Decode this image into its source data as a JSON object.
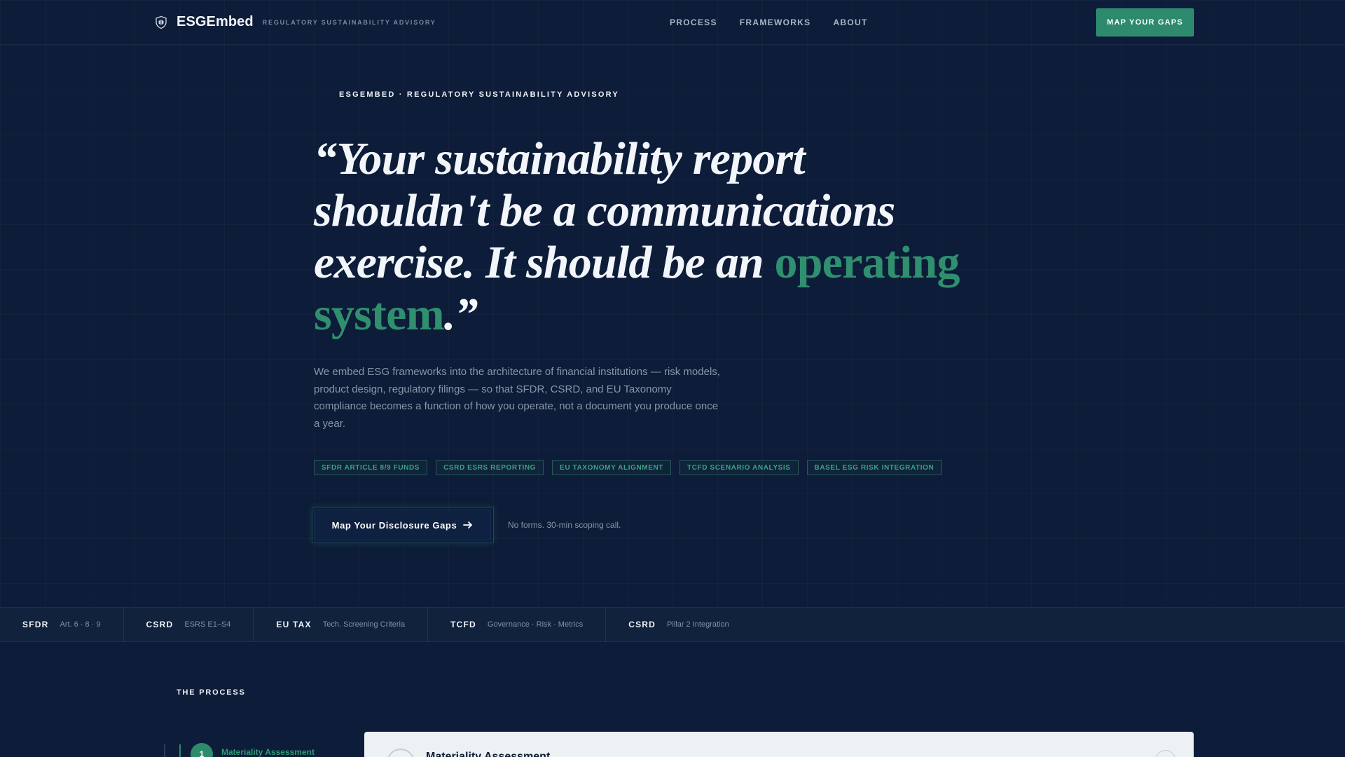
{
  "nav": {
    "brand": "ESGEmbed",
    "tagline": "REGULATORY SUSTAINABILITY ADVISORY",
    "links": [
      "PROCESS",
      "FRAMEWORKS",
      "ABOUT"
    ],
    "cta": "MAP YOUR GAPS"
  },
  "hero": {
    "eyebrow": "ESGEMBED · REGULATORY SUSTAINABILITY ADVISORY",
    "quote_part1": "“Your sustainability report shouldn't be a communications exercise. It should be an ",
    "quote_accent": "operating system",
    "quote_part2": ".”",
    "lede": "We embed ESG frameworks into the architecture of financial institutions — risk models, product design, regulatory filings — so that SFDR, CSRD, and EU Taxonomy compliance becomes a function of how you operate, not a document you produce once a year.",
    "tags": [
      "SFDR ARTICLE 8/9 FUNDS",
      "CSRD ESRS REPORTING",
      "EU TAXONOMY ALIGNMENT",
      "TCFD SCENARIO ANALYSIS",
      "BASEL ESG RISK INTEGRATION"
    ],
    "cta": "Map Your Disclosure Gaps",
    "cta_note": "No forms. 30-min scoping call."
  },
  "ticker": [
    {
      "code": "SFDR",
      "desc": "Art. 6 · 8 · 9"
    },
    {
      "code": "CSRD",
      "desc": "ESRS E1–S4"
    },
    {
      "code": "EU TAX",
      "desc": "Tech. Screening Criteria"
    },
    {
      "code": "TCFD",
      "desc": "Governance · Risk · Metrics"
    },
    {
      "code": "CSRD",
      "desc": "Pillar 2 Integration"
    }
  ],
  "process": {
    "label": "THE PROCESS",
    "active_step": {
      "number": "1",
      "label": "Materiality Assessment"
    },
    "card_title": "Materiality Assessment"
  },
  "colors": {
    "background": "#0d1c38",
    "accent": "#2d8a6c",
    "text": "#f2f5f9",
    "muted": "#8995a8"
  },
  "icons": {
    "logo": "shield-leaf-icon",
    "cta": "arrow-right-icon"
  }
}
